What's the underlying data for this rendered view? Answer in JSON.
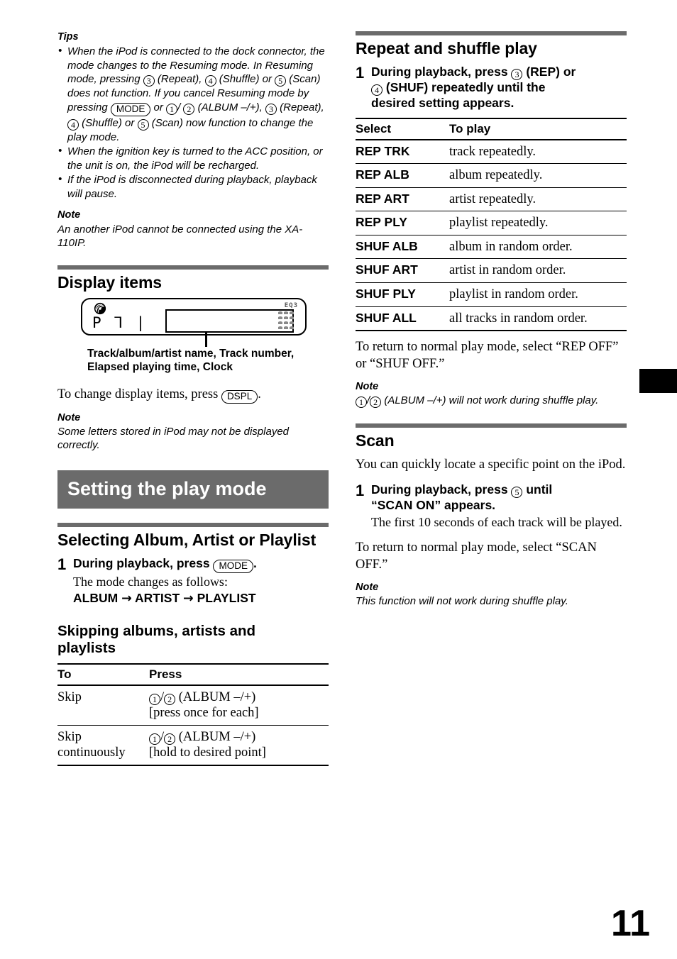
{
  "page_number": "11",
  "left_column": {
    "tips": {
      "heading": "Tips",
      "items": [
        "When the iPod is connected to the dock connector, the mode changes to the Resuming mode. In Resuming mode, pressing ③ (Repeat), ④ (Shuffle) or ⑤ (Scan) does not function. If you cancel Resuming mode by pressing (MODE) or ①/② (ALBUM –/+), ③ (Repeat), ④ (Shuffle) or ⑤ (Scan) now function to change the play mode.",
        "When the ignition key is turned to the ACC position, or the unit is on, the iPod will be recharged.",
        "If the iPod is disconnected during playback, playback will pause."
      ]
    },
    "note_ipod": {
      "heading": "Note",
      "body": "An another iPod cannot be connected using the XA-110IP."
    },
    "display_items": {
      "heading": "Display items",
      "illustration": {
        "disc_icon": "disc-icon",
        "segment_text": "P ⅂ |",
        "eq_label": "EQ3",
        "caption_line1": "Track/album/artist name, Track number,",
        "caption_line2": "Elapsed playing time, Clock"
      },
      "instruction_prefix": "To change display items, press",
      "button": "DSPL",
      "instruction_suffix": ".",
      "note_heading": "Note",
      "note_body": "Some letters stored in iPod may not be displayed correctly."
    },
    "banner": "Setting the play mode",
    "selecting": {
      "heading": "Selecting Album, Artist or Playlist",
      "step_number": "1",
      "step_lead_prefix": "During playback, press",
      "step_button": "MODE",
      "step_lead_suffix": ".",
      "step_sub": "The mode changes as follows:",
      "sequence": [
        "ALBUM",
        "ARTIST",
        "PLAYLIST"
      ],
      "arrow": "→"
    },
    "skipping": {
      "heading_line1": "Skipping albums, artists and",
      "heading_line2": "playlists",
      "table": {
        "headers": [
          "To",
          "Press"
        ],
        "rows": [
          {
            "to": "Skip",
            "to_line2": "",
            "buttons": [
              "1",
              "2"
            ],
            "press_label": "(ALBUM –/+)",
            "press_detail": "[press once for each]"
          },
          {
            "to": "Skip",
            "to_line2": "continuously",
            "buttons": [
              "1",
              "2"
            ],
            "press_label": "(ALBUM –/+)",
            "press_detail": "[hold to desired point]"
          }
        ]
      }
    }
  },
  "right_column": {
    "repeat_shuffle": {
      "heading": "Repeat and shuffle play",
      "step_number": "1",
      "step_part1": "During playback, press",
      "step_btn1": "3",
      "step_part2": "(REP) or",
      "step_btn2": "4",
      "step_part3": "(SHUF) repeatedly until the",
      "step_part4": "desired setting appears.",
      "table": {
        "headers": [
          "Select",
          "To play"
        ],
        "rows": [
          {
            "select": "REP TRK",
            "to_play": "track repeatedly."
          },
          {
            "select": "REP ALB",
            "to_play": "album repeatedly."
          },
          {
            "select": "REP ART",
            "to_play": "artist repeatedly."
          },
          {
            "select": "REP PLY",
            "to_play": "playlist repeatedly."
          },
          {
            "select": "SHUF ALB",
            "to_play": "album in random order."
          },
          {
            "select": "SHUF ART",
            "to_play": "artist in random order."
          },
          {
            "select": "SHUF PLY",
            "to_play": "playlist in random order."
          },
          {
            "select": "SHUF ALL",
            "to_play": "all tracks in random order."
          }
        ]
      },
      "return_text": "To return to normal play mode, select “REP OFF” or “SHUF OFF.”",
      "note_heading": "Note",
      "note_buttons": [
        "1",
        "2"
      ],
      "note_body": "(ALBUM –/+) will not work during shuffle play."
    },
    "scan": {
      "heading": "Scan",
      "intro": "You can quickly locate a specific point on the iPod.",
      "step_number": "1",
      "step_part1": "During playback, press",
      "step_btn": "5",
      "step_part2": "until",
      "step_part3": "“SCAN ON” appears.",
      "step_sub": "The first 10 seconds of each track will be played.",
      "return_text": "To return to normal play mode, select “SCAN OFF.”",
      "note_heading": "Note",
      "note_body": "This function will not work during shuffle play."
    }
  }
}
